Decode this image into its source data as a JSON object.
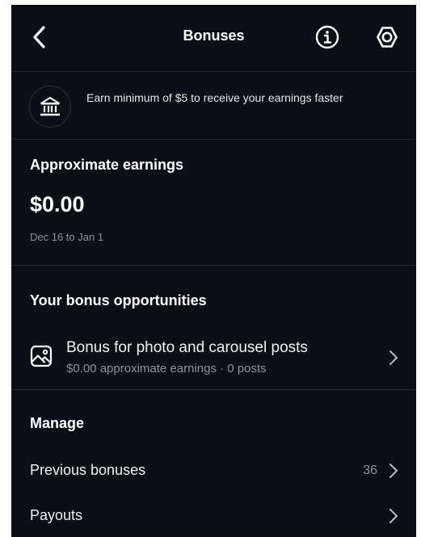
{
  "header": {
    "title": "Bonuses"
  },
  "banner": {
    "text": "Earn minimum of $5 to receive your earnings faster"
  },
  "earnings": {
    "title": "Approximate earnings",
    "amount": "$0.00",
    "date_range": "Dec 16 to Jan 1"
  },
  "opportunities": {
    "title": "Your bonus opportunities",
    "items": [
      {
        "title": "Bonus for photo and carousel posts",
        "subtitle": "$0.00 approximate earnings · 0 posts"
      }
    ]
  },
  "manage": {
    "title": "Manage",
    "items": [
      {
        "label": "Previous bonuses",
        "count": "36"
      },
      {
        "label": "Payouts"
      }
    ]
  },
  "colors": {
    "background": "#0c0f13",
    "divider": "#23272d",
    "text_primary": "#ffffff",
    "text_secondary": "#8d939b"
  },
  "icons": [
    "back-arrow-icon",
    "info-icon",
    "settings-icon",
    "bank-icon",
    "photo-icon",
    "chevron-right-icon"
  ]
}
